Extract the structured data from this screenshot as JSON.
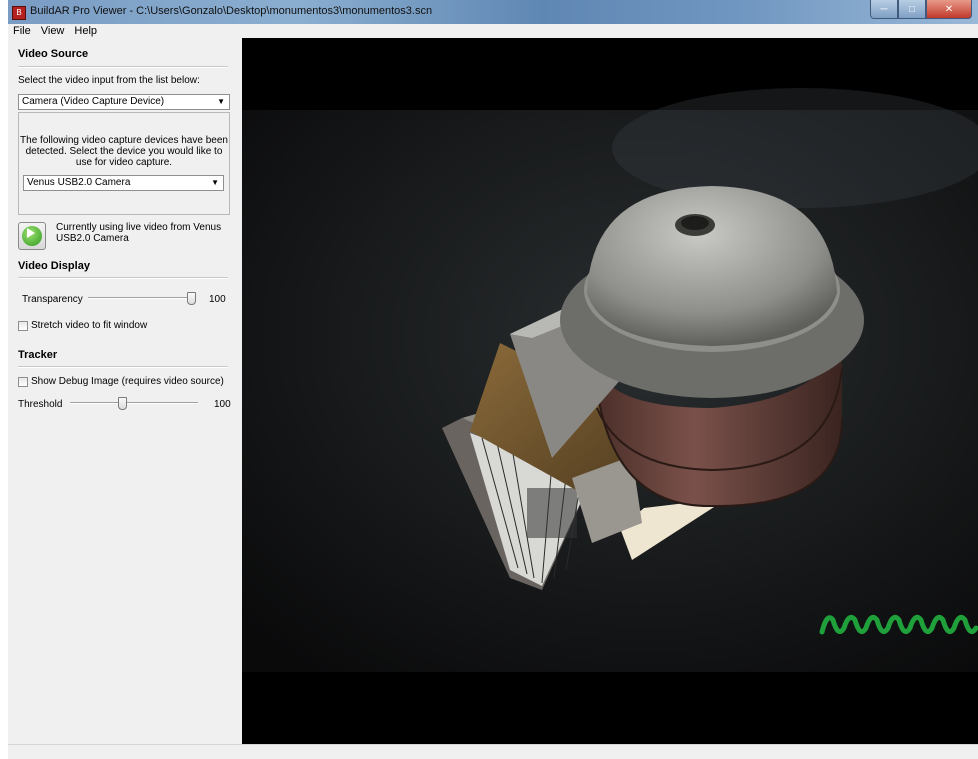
{
  "window": {
    "title": "BuildAR Pro Viewer - C:\\Users\\Gonzalo\\Desktop\\monumentos3\\monumentos3.scn",
    "minimize": "─",
    "maximize": "□",
    "close": "✕"
  },
  "menu": {
    "items": [
      "File",
      "View",
      "Help"
    ]
  },
  "video_source": {
    "title": "Video Source",
    "instruction": "Select the video input from the list below:",
    "selected_input": "Camera (Video Capture Device)",
    "devices_description": "The following video capture devices have been detected. Select the device you would like to use for video capture.",
    "selected_device": "Venus USB2.0 Camera",
    "status": "Currently using live video from Venus USB2.0 Camera"
  },
  "video_display": {
    "title": "Video Display",
    "transparency_label": "Transparency",
    "transparency_value": "100",
    "transparency_fraction": 1.0,
    "stretch_label": "Stretch video to fit window",
    "stretch_checked": false
  },
  "tracker": {
    "title": "Tracker",
    "debug_label": "Show Debug Image (requires video source)",
    "debug_checked": false,
    "threshold_label": "Threshold",
    "threshold_value": "100",
    "threshold_fraction": 0.4
  },
  "viewport": {
    "scene": "3D Pantheon model over live camera video",
    "signal_color": "#1fa03a"
  }
}
